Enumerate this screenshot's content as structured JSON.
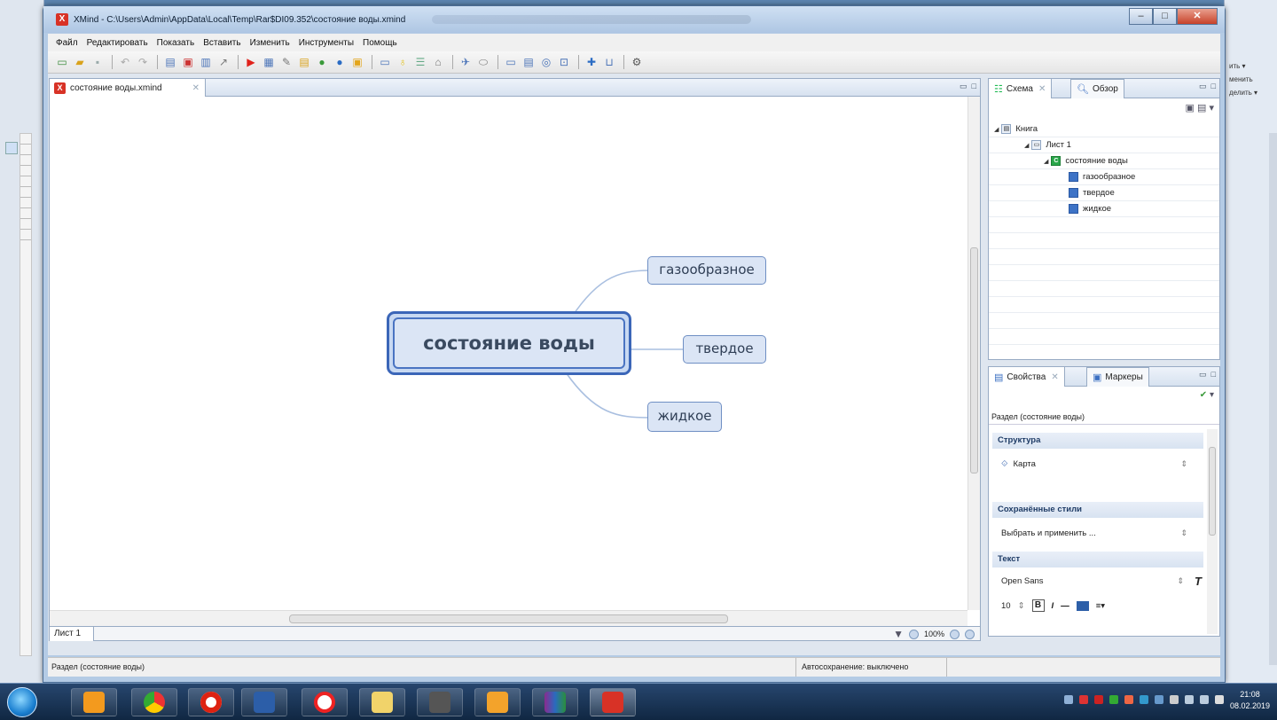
{
  "window": {
    "title": "XMind - C:\\Users\\Admin\\AppData\\Local\\Temp\\Rar$DI09.352\\состояние воды.xmind"
  },
  "menu": [
    "Файл",
    "Редактировать",
    "Показать",
    "Вставить",
    "Изменить",
    "Инструменты",
    "Помощь"
  ],
  "toolbar_icons": [
    "new-icon",
    "open-icon",
    "save-icon",
    "undo-icon",
    "redo-icon",
    "topic-icon",
    "subtopic-icon",
    "detached-icon",
    "relationship-icon",
    "presentation-icon",
    "drill-icon",
    "insert-icon",
    "attach-icon",
    "note-icon",
    "label-icon",
    "marker-icon",
    "image-icon",
    "link-icon",
    "comment-icon",
    "task-icon",
    "filter-icon",
    "share-icon",
    "layout-icon",
    "theme-icon",
    "search-icon",
    "zoom-icon",
    "export-icon",
    "upload-icon",
    "settings-icon"
  ],
  "editor": {
    "tab_label": "состояние воды.xmind",
    "sheet_tab": "Лист 1",
    "zoom": "100%"
  },
  "mindmap": {
    "central": "состояние воды",
    "subtopics": [
      "газообразное",
      "твердое",
      "жидкое"
    ]
  },
  "outline": {
    "tabs": [
      "Схема",
      "Обзор"
    ],
    "tree": [
      {
        "label": "Книга",
        "level": 0
      },
      {
        "label": "Лист 1",
        "level": 1
      },
      {
        "label": "состояние воды",
        "level": 2
      },
      {
        "label": "газообразное",
        "level": 3
      },
      {
        "label": "твердое",
        "level": 3
      },
      {
        "label": "жидкое",
        "level": 3
      }
    ]
  },
  "properties": {
    "tabs": [
      "Свойства",
      "Маркеры"
    ],
    "header": "Раздел (состояние воды)",
    "sections": {
      "structure": {
        "title": "Структура",
        "value": "Карта"
      },
      "saved_styles": {
        "title": "Сохранённые стили",
        "value": "Выбрать и применить ..."
      },
      "text": {
        "title": "Текст",
        "font": "Open Sans",
        "size": "10"
      }
    }
  },
  "status": {
    "left": "Раздел (состояние воды)",
    "autosave": "Автосохранение: выключено"
  },
  "background_app": {
    "right_labels": [
      "ить ▾",
      "менить",
      "делить ▾"
    ]
  },
  "clock": {
    "time": "21:08",
    "date": "08.02.2019"
  },
  "colors": {
    "central_border": "#3b66b8",
    "topic_fill": "#dbe5f5",
    "topic_border": "#6f8fc4",
    "connector": "#a9bfe0"
  }
}
